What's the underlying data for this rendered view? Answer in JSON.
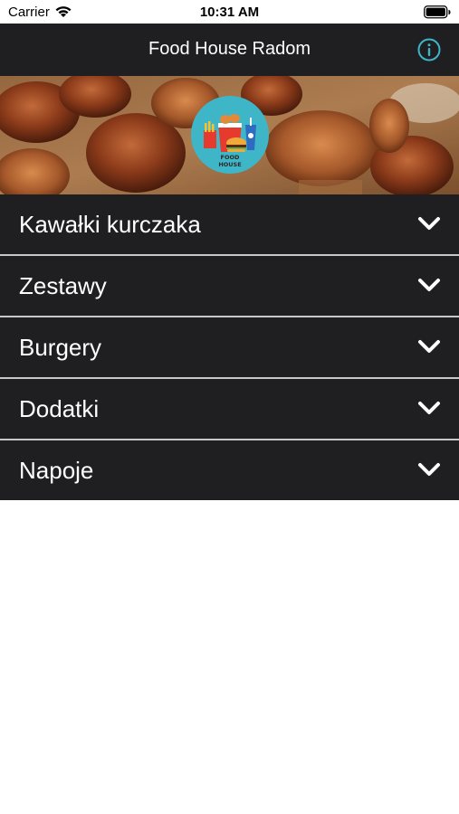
{
  "status_bar": {
    "carrier": "Carrier",
    "time": "10:31 AM"
  },
  "nav": {
    "title": "Food House Radom",
    "info_icon": "info-circle-icon",
    "accent_color": "#3fb6c8"
  },
  "hero": {
    "logo_text_line1": "FOOD",
    "logo_text_line2": "HOUSE"
  },
  "categories": [
    {
      "label": "Kawałki kurczaka"
    },
    {
      "label": "Zestawy"
    },
    {
      "label": "Burgery"
    },
    {
      "label": "Dodatki"
    },
    {
      "label": "Napoje"
    }
  ],
  "colors": {
    "bar_background": "#1f1f21",
    "separator": "#c7c7cc",
    "text": "#ffffff"
  }
}
